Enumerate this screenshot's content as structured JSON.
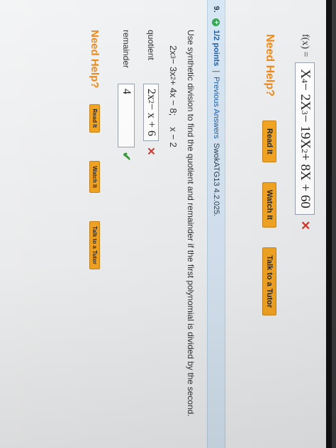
{
  "prev_question": {
    "fx_label": "f(x) =",
    "answer": {
      "t1": "X",
      "e1": "4",
      "t2": " − 2X",
      "e2": "3",
      "t3": " − 19X",
      "e3": "2",
      "t4": " + 8X + 60"
    },
    "need_help": "Need Help?",
    "buttons": [
      "Read It",
      "Watch It",
      "Talk to a Tutor"
    ]
  },
  "question": {
    "number": "9.",
    "points": "1/2 points",
    "separator": "|",
    "previous_answers": "Previous Answers",
    "code": "SwokATG13 4.2.025.",
    "instruction": "Use synthetic division to find the quotient and remainder if the first polynomial is divided by the second.",
    "polynomial": {
      "p1": "2x",
      "e1": "3",
      "p2": " − 3x",
      "e2": "2",
      "p3": " + 4x − 8;",
      "divisor": "x − 2"
    },
    "quotient_label": "quotient",
    "quotient_answer": {
      "q1": "2x",
      "e1": "2",
      "q2": " − x + 6"
    },
    "remainder_label": "remainder",
    "remainder_answer": "4",
    "need_help": "Need Help?",
    "buttons": [
      "Read It",
      "Watch It",
      "Talk to a Tutor"
    ]
  },
  "colors": {
    "accent_orange": "#f5a623",
    "error_red": "#d83a2e",
    "success_green": "#3a9b3a",
    "header_blue": "#d7e6f3"
  },
  "icons": {
    "incorrect": "x-mark-icon",
    "correct": "check-mark-icon",
    "points": "plus-circle-icon"
  }
}
